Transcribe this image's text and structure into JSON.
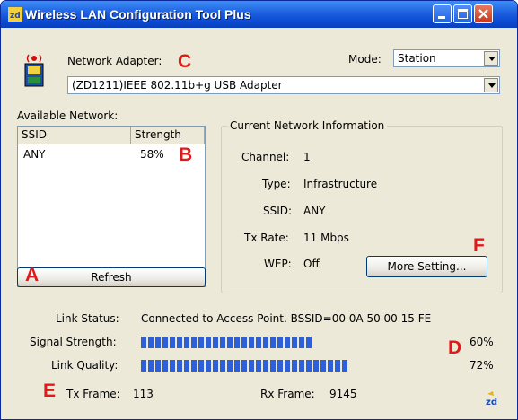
{
  "window": {
    "title": "Wireless LAN Configuration Tool Plus"
  },
  "markers": {
    "a": "A",
    "b": "B",
    "c": "C",
    "d": "D",
    "e": "E",
    "f": "F"
  },
  "adapter": {
    "label": "Network Adapter:",
    "value": "(ZD1211)IEEE 802.11b+g USB Adapter",
    "icon": "zd-adapter-icon"
  },
  "mode": {
    "label": "Mode:",
    "value": "Station"
  },
  "available": {
    "label": "Available Network:",
    "columns": [
      "SSID",
      "Strength"
    ],
    "rows": [
      {
        "ssid": "ANY",
        "strength": "58%"
      }
    ],
    "refresh_label": "Refresh"
  },
  "current": {
    "title": "Current Network Information",
    "channel_label": "Channel:",
    "channel": "1",
    "type_label": "Type:",
    "type": "Infrastructure",
    "ssid_label": "SSID:",
    "ssid": "ANY",
    "txrate_label": "Tx Rate:",
    "txrate": "11 Mbps",
    "wep_label": "WEP:",
    "wep": "Off",
    "more_label": "More Setting..."
  },
  "status": {
    "link_label": "Link Status:",
    "link_value": "Connected to Access Point. BSSID=00 0A 50 00 15 FE",
    "signal_label": "Signal Strength:",
    "signal_value": "60%",
    "signal_fraction": 0.6,
    "quality_label": "Link Quality:",
    "quality_value": "72%",
    "quality_fraction": 0.72,
    "tx_label": "Tx Frame:",
    "tx_value": "113",
    "rx_label": "Rx Frame:",
    "rx_value": "9145"
  },
  "colors": {
    "bar": "#2d5fd8",
    "marker": "#e01a1a",
    "titlebar": "#0a48d1"
  }
}
